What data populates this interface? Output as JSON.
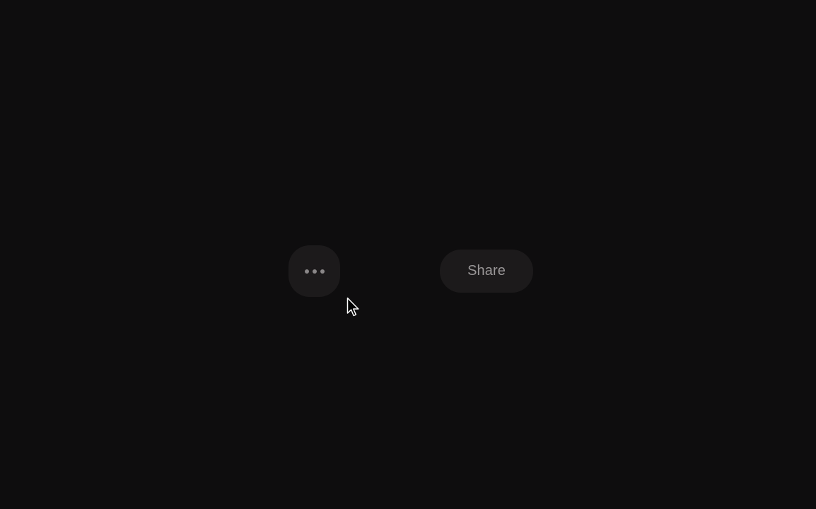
{
  "toolbar": {
    "more_icon": "ellipsis-horizontal-icon",
    "share_label": "Share"
  },
  "pointer": {
    "icon": "arrow-cursor-icon"
  },
  "colors": {
    "background": "#0e0d0e",
    "button_bg": "#1c1a1b",
    "text": "#9a9798",
    "dot": "#8a8788"
  }
}
